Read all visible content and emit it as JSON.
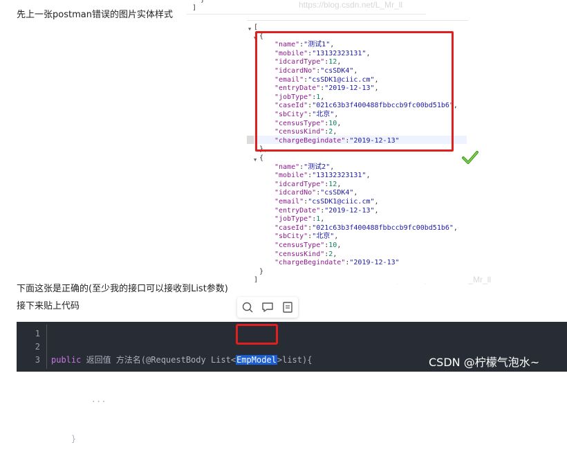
{
  "intro_text": "先上一张postman错误的图片实体样式",
  "watermark_top": "https://blog.csdn.net/L_Mr_ll",
  "watermark_mid": "https://blog.csdn.net/L_Mr_ll",
  "top_code_fragment": "  }\n]",
  "json_view": {
    "open_array": "[",
    "close_array": "]",
    "open_obj": "{",
    "close_obj_comma": "},",
    "close_obj": "}",
    "object1": [
      {
        "key": "\"name\"",
        "value": "\"测试1\"",
        "kind": "s"
      },
      {
        "key": "\"mobile\"",
        "value": "\"13132323131\"",
        "kind": "s"
      },
      {
        "key": "\"idcardType\"",
        "value": "12",
        "kind": "n"
      },
      {
        "key": "\"idcardNo\"",
        "value": "\"csSDK4\"",
        "kind": "s"
      },
      {
        "key": "\"email\"",
        "value": "\"csSDK1@ciic.cm\"",
        "kind": "s"
      },
      {
        "key": "\"entryDate\"",
        "value": "\"2019-12-13\"",
        "kind": "s"
      },
      {
        "key": "\"jobType\"",
        "value": "1",
        "kind": "n"
      },
      {
        "key": "\"caseId\"",
        "value": "\"021c63b3f400488fbbccb9fc00bd51b6\"",
        "kind": "s"
      },
      {
        "key": "\"sbCity\"",
        "value": "\"北京\"",
        "kind": "s"
      },
      {
        "key": "\"censusType\"",
        "value": "10",
        "kind": "n"
      },
      {
        "key": "\"censusKind\"",
        "value": "2",
        "kind": "n"
      },
      {
        "key": "\"chargeBegindate\"",
        "value": "\"2019-12-13\"",
        "kind": "s",
        "last": true
      }
    ],
    "object2": [
      {
        "key": "\"name\"",
        "value": "\"测试2\"",
        "kind": "s"
      },
      {
        "key": "\"mobile\"",
        "value": "\"13132323131\"",
        "kind": "s"
      },
      {
        "key": "\"idcardType\"",
        "value": "12",
        "kind": "n"
      },
      {
        "key": "\"idcardNo\"",
        "value": "\"csSDK4\"",
        "kind": "s"
      },
      {
        "key": "\"email\"",
        "value": "\"csSDK1@ciic.cm\"",
        "kind": "s"
      },
      {
        "key": "\"entryDate\"",
        "value": "\"2019-12-13\"",
        "kind": "s"
      },
      {
        "key": "\"jobType\"",
        "value": "1",
        "kind": "n"
      },
      {
        "key": "\"caseId\"",
        "value": "\"021c63b3f400488fbbccb9fc00bd51b6\"",
        "kind": "s"
      },
      {
        "key": "\"sbCity\"",
        "value": "\"北京\"",
        "kind": "s"
      },
      {
        "key": "\"censusType\"",
        "value": "10",
        "kind": "n"
      },
      {
        "key": "\"censusKind\"",
        "value": "2",
        "kind": "n"
      },
      {
        "key": "\"chargeBegindate\"",
        "value": "\"2019-12-13\"",
        "kind": "s",
        "last": true
      }
    ]
  },
  "caption_correct": "下面这张是正确的(至少我的接口可以接收到List参数)",
  "caption_code": "接下来贴上代码",
  "code": {
    "line_numbers": [
      "1",
      "2",
      "3"
    ],
    "line1_kw": "public",
    "line1_pre": " 返回值 方法名(@RequestBody List<",
    "line1_sel": "EmpModel",
    "line1_post": ">list){",
    "line2": "        ...",
    "line3": "    }"
  },
  "csdn_watermark": "CSDN @柠檬气泡水~"
}
